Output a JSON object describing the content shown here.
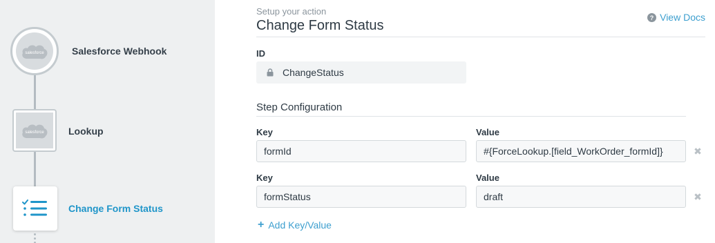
{
  "steps": [
    {
      "label": "Salesforce Webhook",
      "icon": "salesforce-cloud-icon",
      "logo_text": "salesforce",
      "shape": "circle"
    },
    {
      "label": "Lookup",
      "icon": "salesforce-cloud-icon",
      "logo_text": "salesforce",
      "shape": "square"
    },
    {
      "label": "Change Form Status",
      "icon": "checklist-icon",
      "shape": "square",
      "active": true
    }
  ],
  "header": {
    "subtitle": "Setup your action",
    "title": "Change Form Status",
    "docs_label": "View Docs",
    "docs_icon": "question-circle-icon"
  },
  "id_field": {
    "label": "ID",
    "value": "ChangeStatus",
    "icon": "lock-icon"
  },
  "config": {
    "section_title": "Step Configuration",
    "rows": [
      {
        "key_label": "Key",
        "key": "formId",
        "value_label": "Value",
        "value": "#{ForceLookup.[field_WorkOrder_formId]}",
        "remove": "✖"
      },
      {
        "key_label": "Key",
        "key": "formStatus",
        "value_label": "Value",
        "value": "draft",
        "remove": "✖"
      }
    ],
    "add_label": "Add Key/Value",
    "add_icon": "+"
  },
  "colors": {
    "accent": "#3d9fcf",
    "active_step": "#1f95c9",
    "rail_bg": "#eef0f1"
  }
}
